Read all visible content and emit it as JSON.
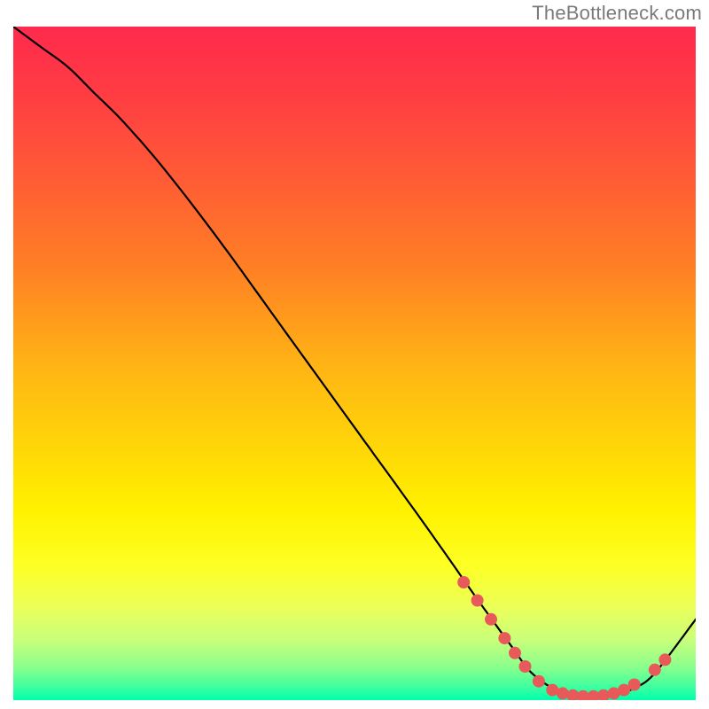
{
  "attribution": "TheBottleneck.com",
  "chart_data": {
    "type": "line",
    "title": "",
    "xlabel": "",
    "ylabel": "",
    "xlim": [
      0,
      100
    ],
    "ylim": [
      0,
      100
    ],
    "grid": false,
    "legend": false,
    "gradient_stops": [
      {
        "offset": 0.0,
        "color": "#ff2a4d"
      },
      {
        "offset": 0.09,
        "color": "#ff3a44"
      },
      {
        "offset": 0.22,
        "color": "#ff5a36"
      },
      {
        "offset": 0.36,
        "color": "#ff8024"
      },
      {
        "offset": 0.5,
        "color": "#ffb315"
      },
      {
        "offset": 0.62,
        "color": "#ffd508"
      },
      {
        "offset": 0.72,
        "color": "#fff200"
      },
      {
        "offset": 0.8,
        "color": "#fdff24"
      },
      {
        "offset": 0.86,
        "color": "#ecff57"
      },
      {
        "offset": 0.91,
        "color": "#c9ff7a"
      },
      {
        "offset": 0.95,
        "color": "#8cff8c"
      },
      {
        "offset": 0.98,
        "color": "#3fff9e"
      },
      {
        "offset": 1.0,
        "color": "#00ffad"
      }
    ],
    "series": [
      {
        "name": "bottleneck-curve",
        "x": [
          0,
          4,
          8,
          12,
          16,
          22,
          30,
          40,
          50,
          60,
          68,
          73,
          76,
          80,
          84,
          88,
          91,
          94,
          100
        ],
        "y": [
          100,
          97,
          94,
          90,
          86,
          79,
          68.5,
          54.5,
          40.5,
          26.5,
          15,
          8,
          4,
          1.3,
          0.5,
          0.7,
          1.8,
          4,
          12
        ]
      }
    ],
    "markers": {
      "name": "highlight-dots",
      "color": "#e85a5a",
      "radius_px": 7,
      "points": [
        {
          "x": 66,
          "y": 17.5
        },
        {
          "x": 68,
          "y": 14.8
        },
        {
          "x": 70,
          "y": 12
        },
        {
          "x": 72,
          "y": 9.2
        },
        {
          "x": 73.5,
          "y": 7
        },
        {
          "x": 75,
          "y": 5
        },
        {
          "x": 77,
          "y": 2.8
        },
        {
          "x": 79,
          "y": 1.5
        },
        {
          "x": 80.5,
          "y": 1.0
        },
        {
          "x": 82,
          "y": 0.7
        },
        {
          "x": 83.5,
          "y": 0.55
        },
        {
          "x": 85,
          "y": 0.55
        },
        {
          "x": 86.5,
          "y": 0.7
        },
        {
          "x": 88,
          "y": 1.0
        },
        {
          "x": 89.5,
          "y": 1.5
        },
        {
          "x": 91,
          "y": 2.3
        },
        {
          "x": 94,
          "y": 4.5
        },
        {
          "x": 95.5,
          "y": 6.0
        }
      ]
    }
  }
}
